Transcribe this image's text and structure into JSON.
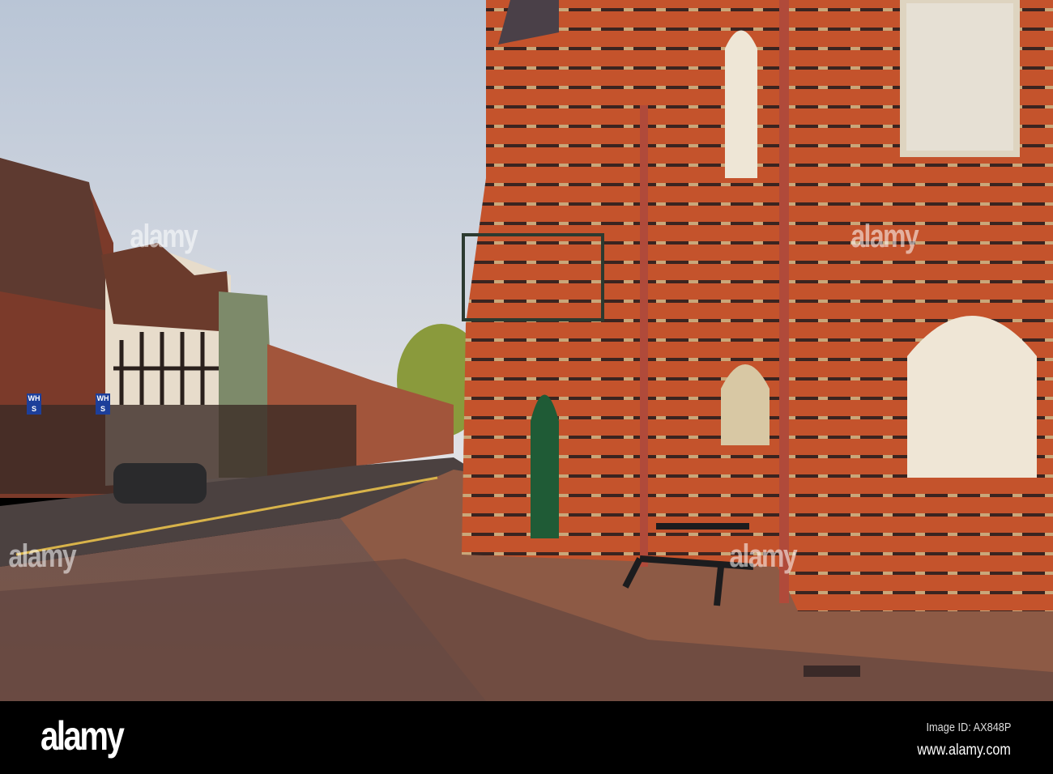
{
  "footer": {
    "logo": "alamy",
    "image_id": "Image ID: AX848P",
    "url": "www.alamy.com"
  },
  "watermarks": [
    "alamy",
    "alamy",
    "alamy",
    "alamy"
  ],
  "shop_signs": [
    "WH S",
    "WH S"
  ],
  "colors": {
    "sky": "#c9d3e0",
    "brick": "#c0502c",
    "paving": "#7a5548",
    "footer": "#000000"
  }
}
